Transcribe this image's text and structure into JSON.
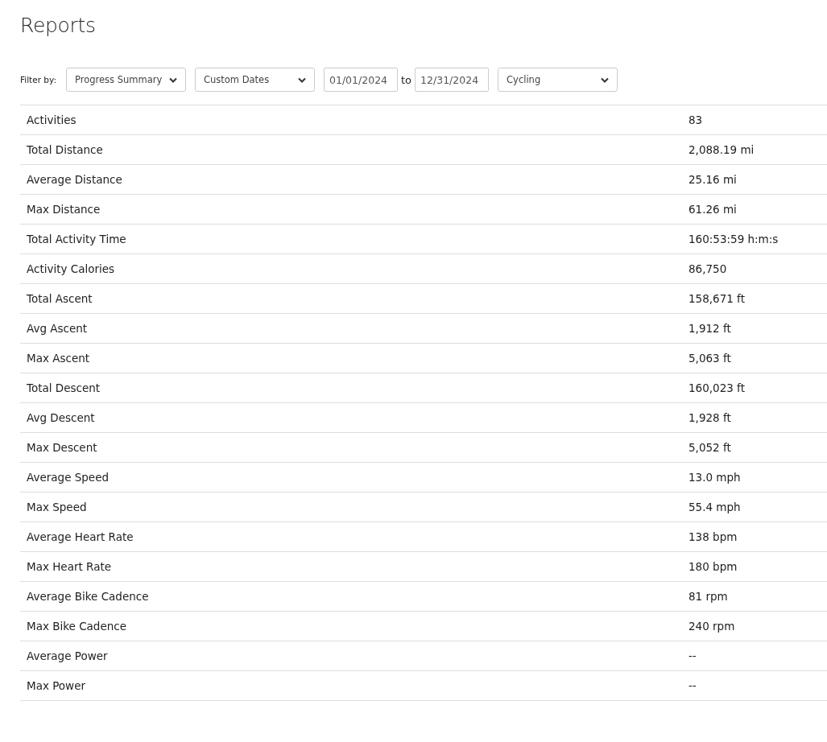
{
  "page": {
    "title": "Reports"
  },
  "filter": {
    "label": "Filter by:",
    "controls": [
      {
        "kind": "select",
        "value": "Progress Summary"
      },
      {
        "kind": "select",
        "value": "Custom Dates"
      },
      {
        "kind": "date",
        "value": "01/01/2024"
      },
      {
        "kind": "separator",
        "value": "to"
      },
      {
        "kind": "date",
        "value": "12/31/2024"
      },
      {
        "kind": "select",
        "value": "Cycling"
      }
    ]
  },
  "table": {
    "rows": [
      {
        "label": "Activities",
        "value": "83"
      },
      {
        "label": "Total Distance",
        "value": "2,088.19 mi"
      },
      {
        "label": "Average Distance",
        "value": "25.16 mi"
      },
      {
        "label": "Max Distance",
        "value": "61.26 mi"
      },
      {
        "label": "Total Activity Time",
        "value": "160:53:59 h:m:s"
      },
      {
        "label": "Activity Calories",
        "value": "86,750"
      },
      {
        "label": "Total Ascent",
        "value": "158,671 ft"
      },
      {
        "label": "Avg Ascent",
        "value": "1,912 ft"
      },
      {
        "label": "Max Ascent",
        "value": "5,063 ft"
      },
      {
        "label": "Total Descent",
        "value": "160,023 ft"
      },
      {
        "label": "Avg Descent",
        "value": "1,928 ft"
      },
      {
        "label": "Max Descent",
        "value": "5,052 ft"
      },
      {
        "label": "Average Speed",
        "value": "13.0 mph"
      },
      {
        "label": "Max Speed",
        "value": "55.4 mph"
      },
      {
        "label": "Average Heart Rate",
        "value": "138 bpm"
      },
      {
        "label": "Max Heart Rate",
        "value": "180 bpm"
      },
      {
        "label": "Average Bike Cadence",
        "value": "81 rpm"
      },
      {
        "label": "Max Bike Cadence",
        "value": "240 rpm"
      },
      {
        "label": "Average Power",
        "value": "--"
      },
      {
        "label": "Max Power",
        "value": "--"
      }
    ]
  }
}
